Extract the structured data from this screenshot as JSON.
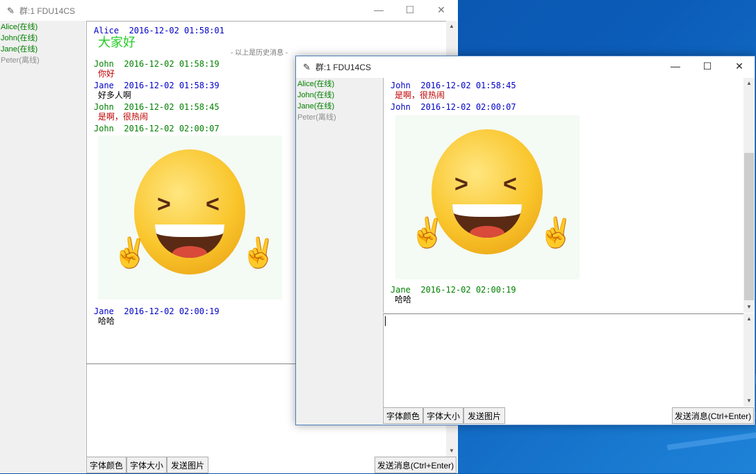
{
  "colors": {
    "online": "#008000",
    "offline": "#8e8e8e",
    "blue_user": "#0000c8",
    "green_user": "#008000",
    "red_text": "#c00000",
    "welcome": "#22cc22"
  },
  "window1": {
    "title": "群:1 FDU14CS",
    "users": [
      {
        "label": "Alice(在线)",
        "status": "online"
      },
      {
        "label": "John(在线)",
        "status": "online"
      },
      {
        "label": "Jane(在线)",
        "status": "online"
      },
      {
        "label": "Peter(离线)",
        "status": "offline"
      }
    ],
    "messages": [
      {
        "head": "Alice  2016-12-02 01:58:01",
        "body": "大家好",
        "head_color": "blue",
        "body_color": "welcome"
      },
      {
        "divider": "- 以上是历史消息 -"
      },
      {
        "head": "John  2016-12-02 01:58:19",
        "body": "你好",
        "head_color": "green",
        "body_color": "red"
      },
      {
        "head": "Jane  2016-12-02 01:58:39",
        "body": "好多人啊",
        "head_color": "blue",
        "body_color": "black"
      },
      {
        "head": "John  2016-12-02 01:58:45",
        "body": "是啊，很热闹",
        "head_color": "green",
        "body_color": "red"
      },
      {
        "head": "John  2016-12-02 02:00:07",
        "image": "laughing-emoji",
        "head_color": "green"
      },
      {
        "head": "Jane  2016-12-02 02:00:19",
        "body": "哈哈",
        "head_color": "blue",
        "body_color": "black"
      }
    ],
    "buttons": {
      "font_color": "字体颜色",
      "font_size": "字体大小",
      "send_image": "发送图片",
      "send_message": "发送消息(Ctrl+Enter)"
    }
  },
  "window2": {
    "title": "群:1 FDU14CS",
    "users": [
      {
        "label": "Alice(在线)",
        "status": "online"
      },
      {
        "label": "John(在线)",
        "status": "online"
      },
      {
        "label": "Jane(在线)",
        "status": "online"
      },
      {
        "label": "Peter(离线)",
        "status": "offline"
      }
    ],
    "messages": [
      {
        "head": "John  2016-12-02 01:58:45",
        "body": "是啊，很热闹",
        "head_color": "blue",
        "body_color": "red"
      },
      {
        "head": "John  2016-12-02 02:00:07",
        "image": "laughing-emoji",
        "head_color": "blue"
      },
      {
        "head": "Jane  2016-12-02 02:00:19",
        "body": "哈哈",
        "head_color": "green",
        "body_color": "black"
      }
    ],
    "buttons": {
      "font_color": "字体颜色",
      "font_size": "字体大小",
      "send_image": "发送图片",
      "send_message": "发送消息(Ctrl+Enter)"
    }
  },
  "icons": {
    "app": "feather-icon",
    "minimize": "minimize-icon",
    "maximize": "maximize-icon",
    "close": "close-icon"
  }
}
